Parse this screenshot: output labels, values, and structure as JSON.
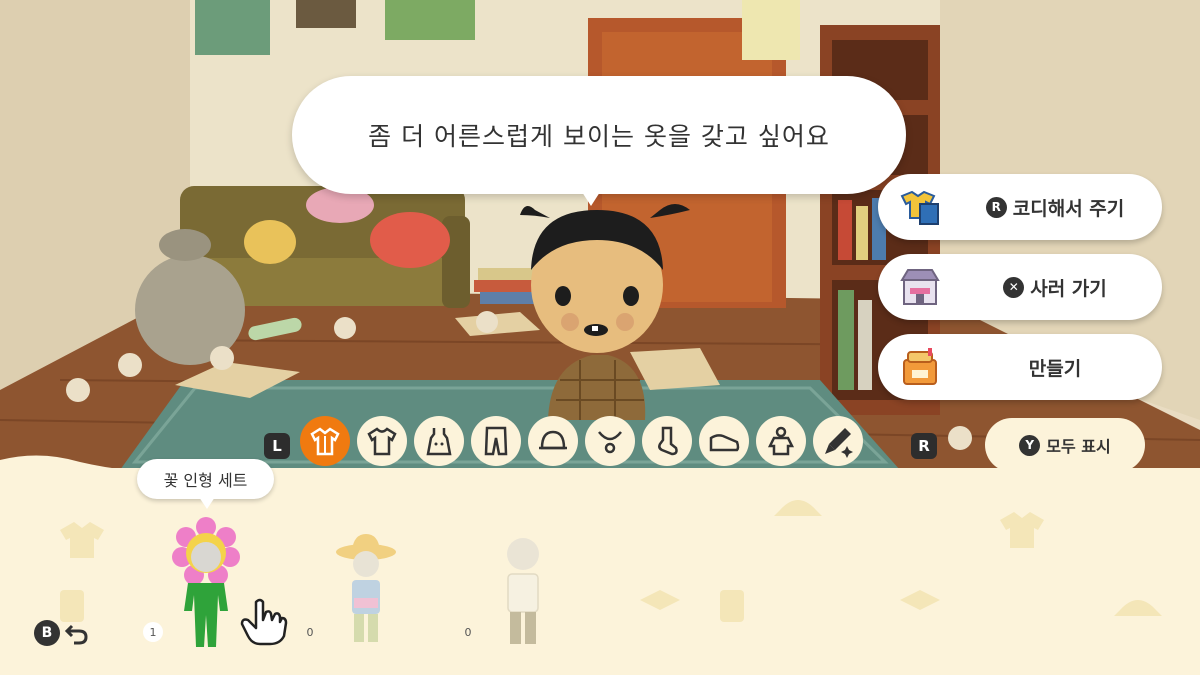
{
  "dialogue": {
    "text": "좀 더 어른스럽게 보이는 옷을 갖고 싶어요"
  },
  "menu": [
    {
      "label": "코디해서 주기",
      "button": "R",
      "icon": "clothes-icon"
    },
    {
      "label": "사러 가기",
      "button": "✕",
      "icon": "shop-icon"
    },
    {
      "label": "만들기",
      "button": "",
      "icon": "workshop-icon"
    }
  ],
  "tabs": {
    "left_key": "L",
    "right_key": "R",
    "items": [
      "set-icon",
      "shirt-icon",
      "dress-icon",
      "pants-icon",
      "hat-icon",
      "necklace-icon",
      "sock-icon",
      "shoe-icon",
      "costume-icon",
      "paint-icon"
    ],
    "selected_index": 0
  },
  "show_all": {
    "button": "Y",
    "label": "모두 표시"
  },
  "tooltip": {
    "label": "꽃 인형 세트"
  },
  "outfits": [
    {
      "count": "1",
      "name": "flower-costume"
    },
    {
      "count": "0",
      "name": "sun-hat-outfit"
    },
    {
      "count": "0",
      "name": "plain-outfit"
    }
  ],
  "back": {
    "button": "B"
  },
  "colors": {
    "accent": "#f07a10",
    "panel": "#fcf3da"
  }
}
